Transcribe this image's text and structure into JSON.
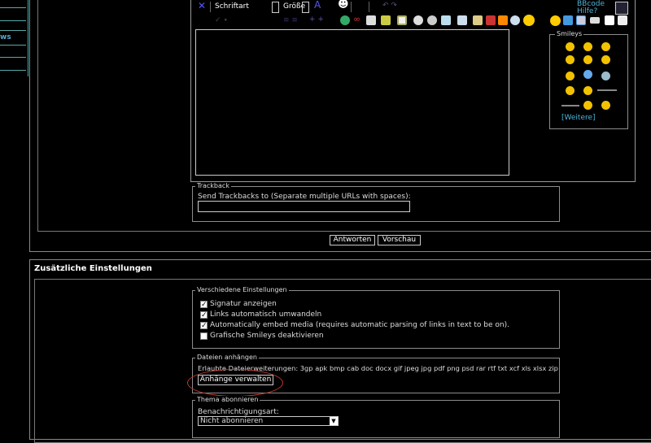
{
  "sidebar": {
    "link_fragment": "ws"
  },
  "toolbar": {
    "font_label": "Schriftart",
    "size_label": "Größe",
    "bbcode_label": "BBcode",
    "help_label": "Hilfe?"
  },
  "smileys": {
    "title": "Smileys",
    "more_link": "[Weitere]"
  },
  "trackback": {
    "legend": "Trackback",
    "label": "Send Trackbacks to (Separate multiple URLs with spaces):",
    "value": ""
  },
  "actions": {
    "reply_label": "Antworten",
    "preview_label": "Vorschau"
  },
  "additional": {
    "heading": "Zusätzliche Einstellungen"
  },
  "misc": {
    "legend": "Verschiedene Einstellungen",
    "options": [
      {
        "label": "Signatur anzeigen",
        "checked": true
      },
      {
        "label": "Links automatisch umwandeln",
        "checked": true
      },
      {
        "label": "Automatically embed media (requires automatic parsing of links in text to be on).",
        "checked": true
      },
      {
        "label": "Grafische Smileys deaktivieren",
        "checked": false
      }
    ]
  },
  "attachments": {
    "legend": "Dateien anhängen",
    "allowed_text": "Erlaubte Dateierweiterungen: 3gp apk bmp cab doc docx gif jpeg jpg pdf png psd rar rtf txt xcf xls xlsx zip",
    "manage_label": "Anhänge verwalten",
    "highlight_color": "#c0392b"
  },
  "subscribe": {
    "legend": "Thema abonnieren",
    "label": "Benachrichtigungsart:",
    "selected": "Nicht abonnieren"
  },
  "colors": {
    "accent": "#5aa6a6",
    "link": "#4fb3d9",
    "smiley": "#f2c200"
  }
}
